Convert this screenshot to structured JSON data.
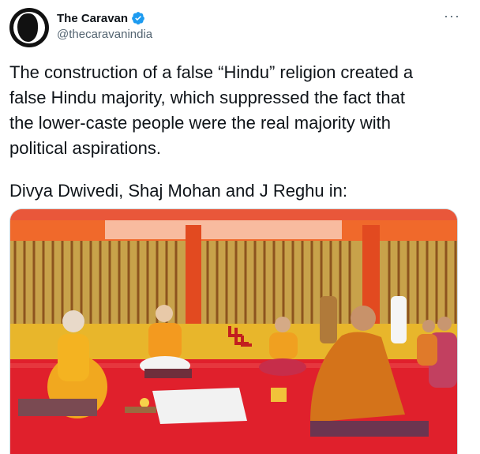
{
  "tweet": {
    "display_name": "The Caravan",
    "handle": "@thecaravanindia",
    "more_icon": "···",
    "verified_icon": "verified-badge",
    "text_lines": [
      "The construction of a false “Hindu” religion created a",
      "false Hindu majority, which suppressed the fact that",
      "the lower-caste people were the real majority with",
      "political aspirations."
    ],
    "byline": "Divya Dwivedi, Shaj Mohan and J Reghu in:"
  },
  "colors": {
    "verified_blue": "#1d9bf0",
    "text": "#0f1419",
    "muted": "#536471",
    "card_border": "#cfd9de"
  }
}
